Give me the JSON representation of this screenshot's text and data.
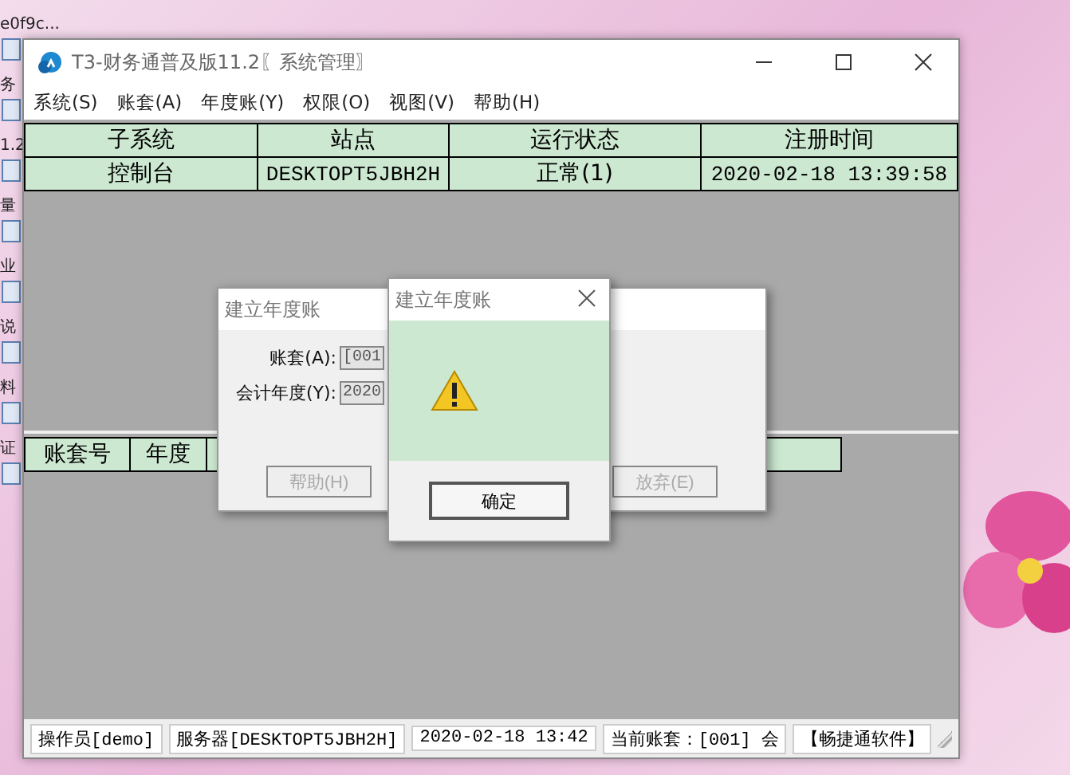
{
  "desktop": {
    "icons": [
      {
        "label": "e0f9c..."
      },
      {
        "label": "务"
      },
      {
        "label": "1.2"
      },
      {
        "label": "量"
      },
      {
        "label": "业"
      },
      {
        "label": "说"
      },
      {
        "label": "料"
      },
      {
        "label": "证"
      }
    ]
  },
  "window": {
    "title": "T3-财务通普及版11.2〖系统管理〗"
  },
  "menu": [
    {
      "label": "系统(S)"
    },
    {
      "label": "账套(A)"
    },
    {
      "label": "年度账(Y)"
    },
    {
      "label": "权限(O)"
    },
    {
      "label": "视图(V)"
    },
    {
      "label": "帮助(H)"
    }
  ],
  "sessions_table": {
    "columns": [
      "子系统",
      "站点",
      "运行状态",
      "注册时间"
    ],
    "rows": [
      [
        "控制台",
        "DESKTOPT5JBH2H",
        "正常(1)",
        "2020-02-18 13:39:58"
      ]
    ]
  },
  "accounts_table": {
    "columns": [
      "账套号",
      "年度"
    ]
  },
  "setup_dialog": {
    "title": "建立年度账",
    "fields": [
      {
        "label": "账套(A):",
        "value": "[001"
      },
      {
        "label": "会计年度(Y):",
        "value": "2020"
      }
    ],
    "buttons": [
      {
        "label": "帮助(H)",
        "disabled": true
      },
      {
        "label": "放弃(E)",
        "disabled": true
      }
    ]
  },
  "alert_dialog": {
    "title": "建立年度账",
    "button": "确定"
  },
  "status_bar": [
    "操作员[demo]",
    "服务器[DESKTOPT5JBH2H]",
    "2020-02-18 13:42",
    "当前账套：[001] 会",
    "【畅捷通软件】"
  ]
}
